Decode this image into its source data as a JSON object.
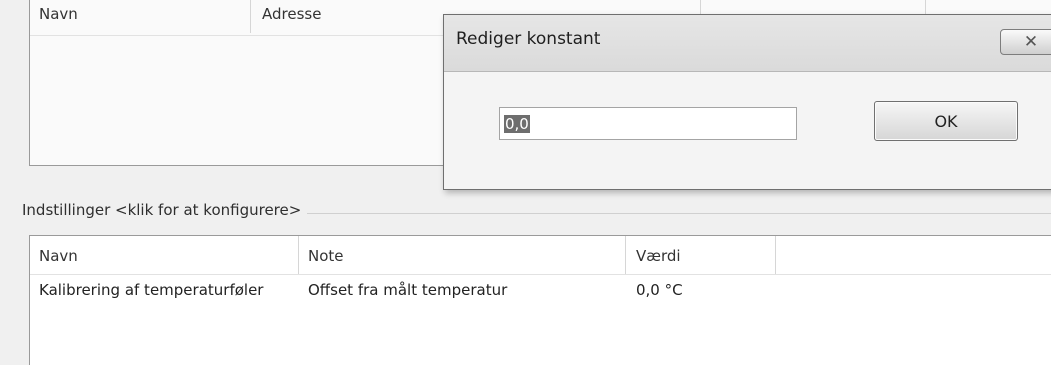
{
  "top_list": {
    "columns": [
      "Navn",
      "Adresse"
    ]
  },
  "dialog": {
    "title": "Rediger konstant",
    "close_label": "✕",
    "input_value": "0,0",
    "ok_label": "OK"
  },
  "settings": {
    "title": "Indstillinger <klik for at konfigurere>",
    "columns": [
      "Navn",
      "Note",
      "Værdi"
    ],
    "rows": [
      [
        "Kalibrering af temperaturføler",
        "Offset fra målt temperatur",
        "0,0 °C"
      ]
    ]
  }
}
